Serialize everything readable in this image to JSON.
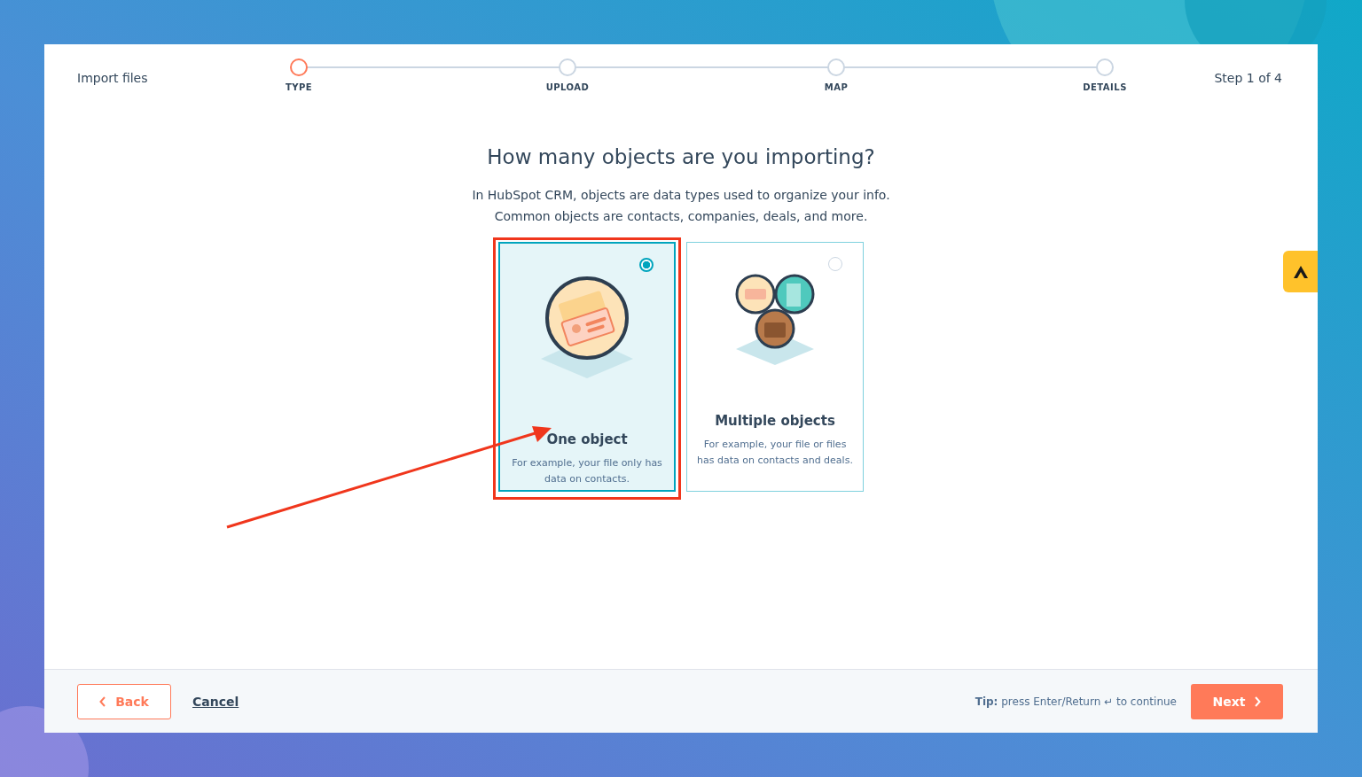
{
  "header": {
    "title": "Import files",
    "step_counter": "Step 1 of 4"
  },
  "steps": [
    {
      "label": "TYPE",
      "selected": true
    },
    {
      "label": "UPLOAD",
      "selected": false
    },
    {
      "label": "MAP",
      "selected": false
    },
    {
      "label": "DETAILS",
      "selected": false
    }
  ],
  "question": {
    "heading": "How many objects are you importing?",
    "description": [
      "In HubSpot CRM, objects are data types used to organize your info.",
      "Common objects are contacts, companies, deals, and more."
    ]
  },
  "options": [
    {
      "kind": "single",
      "title": "One object",
      "description": "For example, your file only has data on contacts.",
      "selected": true
    },
    {
      "kind": "multiple",
      "title": "Multiple objects",
      "description": "For example, your file or files has data on contacts and deals.",
      "selected": false
    }
  ],
  "footer": {
    "back": "Back",
    "cancel": "Cancel",
    "tip": "**Tip:** press Enter/Return ↵ to continue",
    "next": "Next"
  }
}
